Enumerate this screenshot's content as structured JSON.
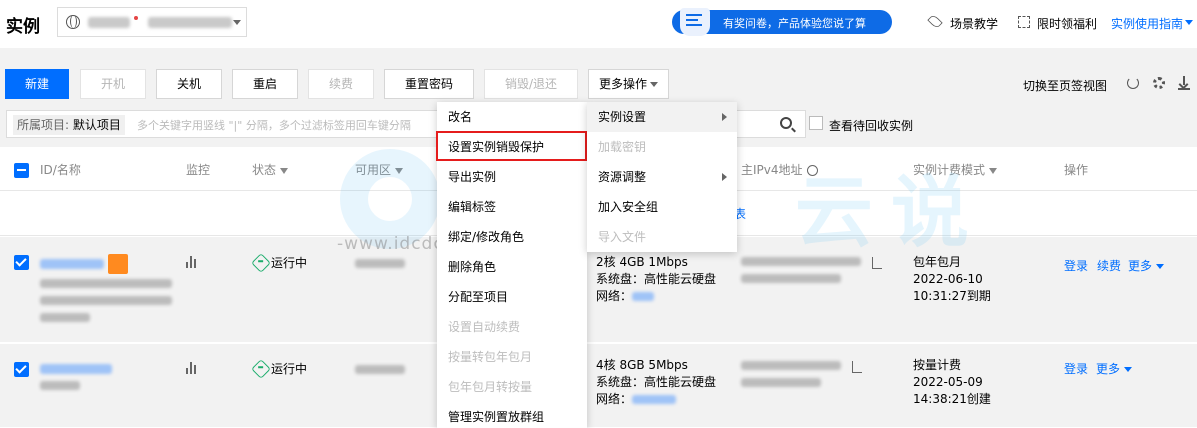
{
  "header": {
    "title": "实例",
    "survey_text": "有奖问卷，产品体验您说了算",
    "links": {
      "tutorial": "场景教学",
      "welfare": "限时领福利",
      "guide": "实例使用指南"
    }
  },
  "toolbar": {
    "buttons": {
      "new": "新建",
      "start": "开机",
      "shutdown": "关机",
      "restart": "重启",
      "renew": "续费",
      "reset_password": "重置密码",
      "destroy": "销毁/退还",
      "more": "更多操作"
    },
    "switch_view": "切换至页签视图"
  },
  "filter": {
    "project_key": "所属项目:",
    "project_value": "默认项目",
    "placeholder": "多个关键字用竖线 \"|\" 分隔，多个过滤标签用回车键分隔",
    "recycle_label": "查看待回收实例"
  },
  "table": {
    "headers": {
      "id_name": "ID/名称",
      "monitor": "监控",
      "status": "状态",
      "zone": "可用区",
      "main_ipv4": "主IPv4地址",
      "billing": "实例计费模式",
      "actions": "操作"
    },
    "empty_link": "表",
    "rows": [
      {
        "status": "运行中",
        "config_line1": "2核 4GB 1Mbps",
        "config_line2": "系统盘：高性能云硬盘",
        "config_line3_label": "网络：",
        "billing_mode": "包年包月",
        "billing_date": "2022-06-10",
        "billing_time": "10:31:27到期",
        "actions": {
          "login": "登录",
          "renew": "续费",
          "more": "更多"
        }
      },
      {
        "status": "运行中",
        "config_line1": "4核 8GB 5Mbps",
        "config_line2": "系统盘：高性能云硬盘",
        "config_line3_label": "网络：",
        "billing_mode": "按量计费",
        "billing_date": "2022-05-09",
        "billing_time": "14:38:21创建",
        "actions": {
          "login": "登录",
          "more": "更多"
        }
      }
    ]
  },
  "menu_main": {
    "items": [
      "改名",
      "设置实例销毁保护",
      "导出实例",
      "编辑标签",
      "绑定/修改角色",
      "删除角色",
      "分配至项目",
      "设置自动续费",
      "按量转包年包月",
      "包年包月转按量",
      "管理实例置放群组"
    ],
    "disabled": [
      false,
      false,
      false,
      false,
      false,
      false,
      false,
      true,
      true,
      true,
      false
    ]
  },
  "menu_sub": {
    "items": [
      "实例设置",
      "加载密钥",
      "资源调整",
      "加入安全组",
      "导入文件"
    ],
    "disabled": [
      false,
      true,
      false,
      false,
      true
    ]
  },
  "watermark": {
    "big": "TALK 云说",
    "sub": "-www.idcdcom-国内专业云计算交流服务平台-"
  },
  "colors": {
    "primary": "#006eff",
    "running": "#1aac6b",
    "highlight": "#e51c1c"
  }
}
